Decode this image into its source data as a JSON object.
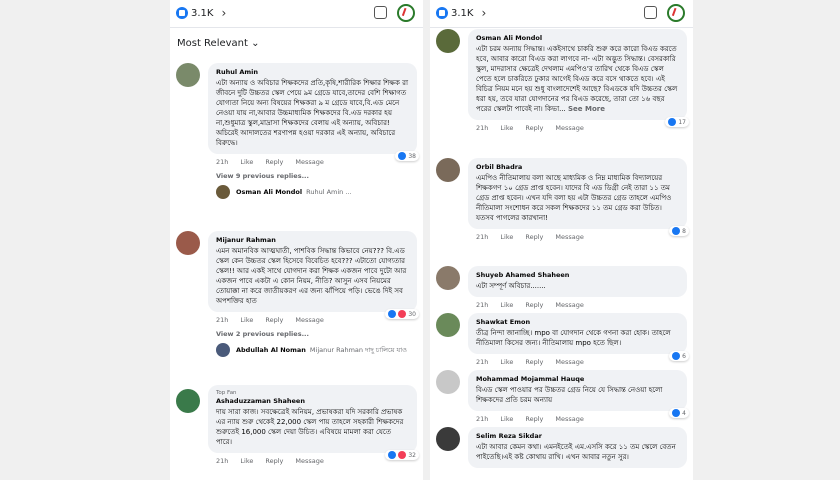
{
  "left": {
    "like_count": "3.1K",
    "sort_label": "Most Relevant",
    "comments": [
      {
        "name": "Ruhul Amin",
        "text": "এটা অন্যায় ও অবিচার শিক্ষকদের প্রতি,কৃষি,শারীরিক শিক্ষার শিক্ষক রা জীবনে দুটি উচ্চতর স্কেল পেয়ে ৯ম গ্রেডে যাবে,তাদের বেশি শিক্ষাগত যোগ্যতা নিয়ে অন্য বিষয়ের শিক্ষকরা ৯ ম গ্রেডে যাবে,বি.এড মেনে নেওয়া যায় না,আবার উচ্চমাধ্যমিক শিক্ষকদের বি.এড দরকার হয় না,শুধুমাত্র স্কুল,মাদ্রাসা শিক্ষকদের বেলায় এই অন্যায়, অবিচার! অচিরেই আদালতের শরণাপন্ন হওয়া দরকার এই অন্যায়, অবিচারে বিরুদ্ধে।",
        "time": "21h",
        "like": "Like",
        "reply": "Reply",
        "message": "Message",
        "reactions": "38",
        "view_replies": "View 9 previous replies...",
        "reply_name": "Osman Ali Mondol",
        "reply_preview": "Ruhul Amin ..."
      },
      {
        "name": "Mijanur Rahman",
        "text": "এমন অমানবিক আত্মঘাতী, পাশবিক সিদ্ধান্ত কিভাবে নেয়??? বি.এড স্কেল কেন উচ্চতর স্কেল হিসেবে বিবেচিত হবে??? এটাতো যোগ্যতার স্কেল!! আর একই সাথে যোগদান করা শিক্ষক একজন পাবে দুটো আর একজন পাবে একটা এ কোন নিয়ম, নীতি? আসুন এসব নিয়মের তোয়াক্কা না করে জাতীয়করণ এর জন্য ঝাঁপিয়ে পড়ি। ভেঙে দিই সব অপশক্তির হাত",
        "time": "21h",
        "like": "Like",
        "reply": "Reply",
        "message": "Message",
        "reactions": "30",
        "view_replies": "View 2 previous replies...",
        "reply_name": "Abdullah Al Noman",
        "reply_preview": "Mijanur Rahman দাদু চালিয়ে যাও"
      },
      {
        "badge": "Top Fan",
        "name": "Ashaduzzaman Shaheen",
        "text": "দায় সারা কাজ। সবক্ষেত্রেই অনিয়ম, প্রভাষকরা যদি সরকারি প্রভাষক এর ন্যায় শুরু থেকেই 22,000 স্কেল পায় তাহলে সহকারী শিক্ষকদের শুরুতেই 16,000 স্কেল দেয়া উচিত। এবিষয়ে মামলা করা যেতে পারে।",
        "time": "21h",
        "like": "Like",
        "reply": "Reply",
        "message": "Message",
        "reactions": "32"
      }
    ]
  },
  "right": {
    "like_count": "3.1K",
    "comments": [
      {
        "name": "Osman Ali Mondol",
        "text": "এটা চরম অন্যায় সিদ্ধান্ত। একইসাথে চাকরি শুরু করে কারো বিএড করতে হবে, আবার কারো বিএড করা লাগবে না- এটা অদ্ভুত সিদ্ধান্ত। বেসরকারি স্কুল, মাদরাসার ক্ষেত্রেই দেখলাম এমপিও'র তারিখ থেকে বিএড স্কেল পেতে হলে চাকরিতে ঢুকার আগেই বিএড করে বসে থাকতে হবে। এই বিচিত্র নিয়ম মনে হয় শুধু বাংলাদেশেই আছে? বিএডকে যদি উচ্চতর স্কেল ধরা হয়, তবে যারা যোগদানের পর বিএড করেছে, তারা তো ১৬ বছর পরের স্কেলটা পাবেই না। কিভা...",
        "see_more": "See More",
        "time": "21h",
        "like": "Like",
        "reply": "Reply",
        "message": "Message",
        "reactions": "17"
      },
      {
        "name": "Orbil Bhadra",
        "text": "এমপিও নীতিমালায় বলা আছে মাধ্যমিক ও নিম্ন মাধ্যমিক বিদ্যালয়ের শিক্ষকগণ ১০ গ্রেড প্রাপ্ত হবেন। যাদের বি এড ডিগ্রী নেই তারা ১১ তম গ্রেড প্রাপ্ত হবেন। এখন যদি বলা হয় এটা উচ্চতর গ্রেড তাহলে এমপিও নীতিমালা সংশোধন করে সকল শিক্ষকদের ১১ তম গ্রেড করা উচিত। যতসব পাগলের কারখানা!",
        "time": "21h",
        "like": "Like",
        "reply": "Reply",
        "message": "Message",
        "reactions": "8"
      },
      {
        "name": "Shuyeb Ahamed Shaheen",
        "text": "এটা সম্পূর্ণ অবিচার.......",
        "time": "21h",
        "like": "Like",
        "reply": "Reply",
        "message": "Message"
      },
      {
        "name": "Shawkat Emon",
        "text": "তীব্র নিন্দা জানাচ্ছি। mpo বা যোগদান থেকে গণনা করা হোক। তাহলে নীতিমালা কিসের জন্য। নীতিমালায় mpo হতে ছিল।",
        "time": "21h",
        "like": "Like",
        "reply": "Reply",
        "message": "Message",
        "reactions": "6"
      },
      {
        "name": "Mohammad Mojammal Hauqe",
        "text": "বিএড স্কেল পাওয়ার পর উচ্চতর গ্রেড নিয়ে যে সিদ্ধান্ত নেওয়া হলো শিক্ষকদের প্রতি চরম অন্যায়",
        "time": "21h",
        "like": "Like",
        "reply": "Reply",
        "message": "Message",
        "reactions": "4"
      },
      {
        "name": "Selim Reza Sikdar",
        "text": "এটা আবার কেমন কথা। এমনইতেই এম.এসসি করে ১১ তম স্কেলে বেতন পাইতেছি।এই কষ্ট কোথায় রাখি। এখন আবার নতুন সুর।"
      }
    ]
  }
}
